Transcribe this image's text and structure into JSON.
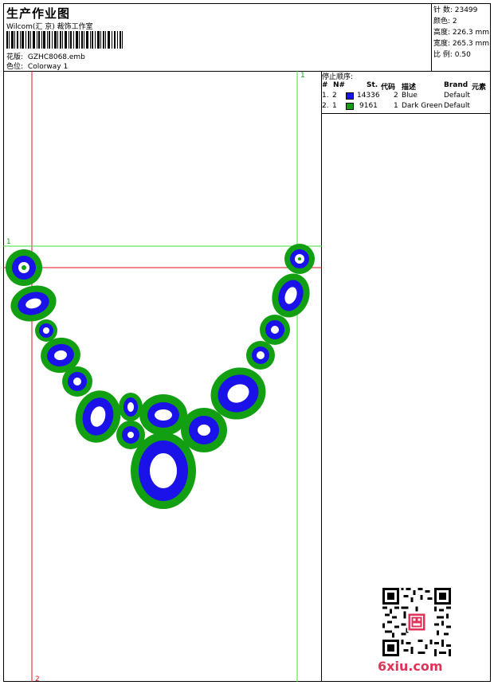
{
  "header": {
    "title": "生产作业图",
    "subtitle": "Wilcom(汇 京) 裁饰工作室",
    "design_label": "花版:",
    "design_value": "GZHC8068.emb",
    "colorway_label": "色位:",
    "colorway_value": "Colorway 1"
  },
  "specs": {
    "stitches": "针 数: 23499",
    "colors": "颜色: 2",
    "height": "高度: 226.3 mm",
    "width": "宽度: 265.3 mm",
    "scale": "比 例: 0.50"
  },
  "design": {
    "hoop_marker_top": "1",
    "hoop_marker_left": "1",
    "hoop_marker_bottom": "2",
    "colors": {
      "blue": "#1a12e8",
      "green": "#12a012",
      "red_line": "#e0141e",
      "green_line": "#3ddc3d"
    }
  },
  "legend": {
    "title": "停止顺序:",
    "headers": {
      "num": "#",
      "needle": "N#",
      "st": "St.",
      "code": "代码",
      "desc": "描述",
      "brand": "Brand",
      "elem": "元素"
    },
    "rows": [
      {
        "num": "1.",
        "needle": "2",
        "swatch": "#1a12e8",
        "st": "14336",
        "code": "2",
        "desc": "Blue",
        "brand": "Default"
      },
      {
        "num": "2.",
        "needle": "1",
        "swatch": "#12a012",
        "st": "9161",
        "code": "1",
        "desc": "Dark Green",
        "brand": "Default"
      }
    ]
  },
  "watermark": {
    "text": "6xiu.com"
  }
}
